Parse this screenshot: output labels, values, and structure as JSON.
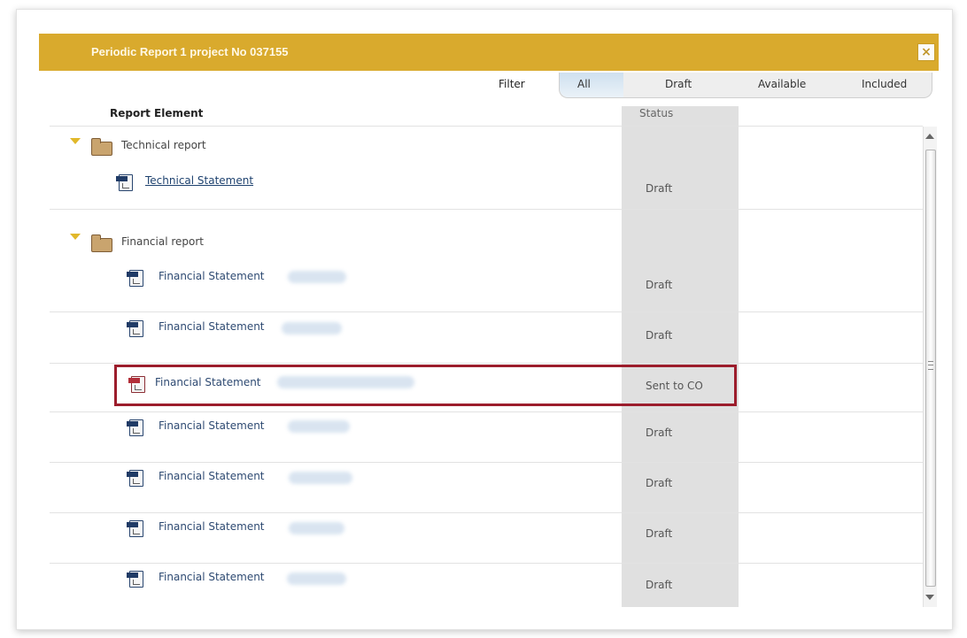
{
  "dialog": {
    "title": "Periodic Report 1 project No 037155",
    "close_icon": "×"
  },
  "filter": {
    "label": "Filter",
    "tabs": [
      {
        "label": "All",
        "active": true
      },
      {
        "label": "Draft"
      },
      {
        "label": "Available"
      },
      {
        "label": "Included"
      }
    ]
  },
  "table": {
    "columns": {
      "report_element": "Report Element",
      "status": "Status"
    },
    "groups": [
      {
        "name": "Technical report",
        "items": [
          {
            "label": "Technical Statement",
            "status": "Draft"
          }
        ]
      },
      {
        "name": "Financial report",
        "items": [
          {
            "label": "Financial Statement",
            "status": "Draft"
          },
          {
            "label": "Financial Statement",
            "status": "Draft"
          },
          {
            "label": "Financial Statement",
            "status": "Sent to CO"
          },
          {
            "label": "Financial Statement",
            "status": "Draft"
          },
          {
            "label": "Financial Statement",
            "status": "Draft"
          },
          {
            "label": "Financial Statement",
            "status": "Draft"
          },
          {
            "label": "Financial Statement",
            "status": "Draft"
          }
        ]
      }
    ]
  },
  "colors": {
    "title_bar": "#d9aa2d",
    "highlight": "#9c1d2c",
    "status_column": "#e0e0e0"
  },
  "icons": {
    "close": "close-icon",
    "folder": "folder-icon",
    "document": "pdf-document-icon",
    "expand": "chevron-down-icon"
  }
}
